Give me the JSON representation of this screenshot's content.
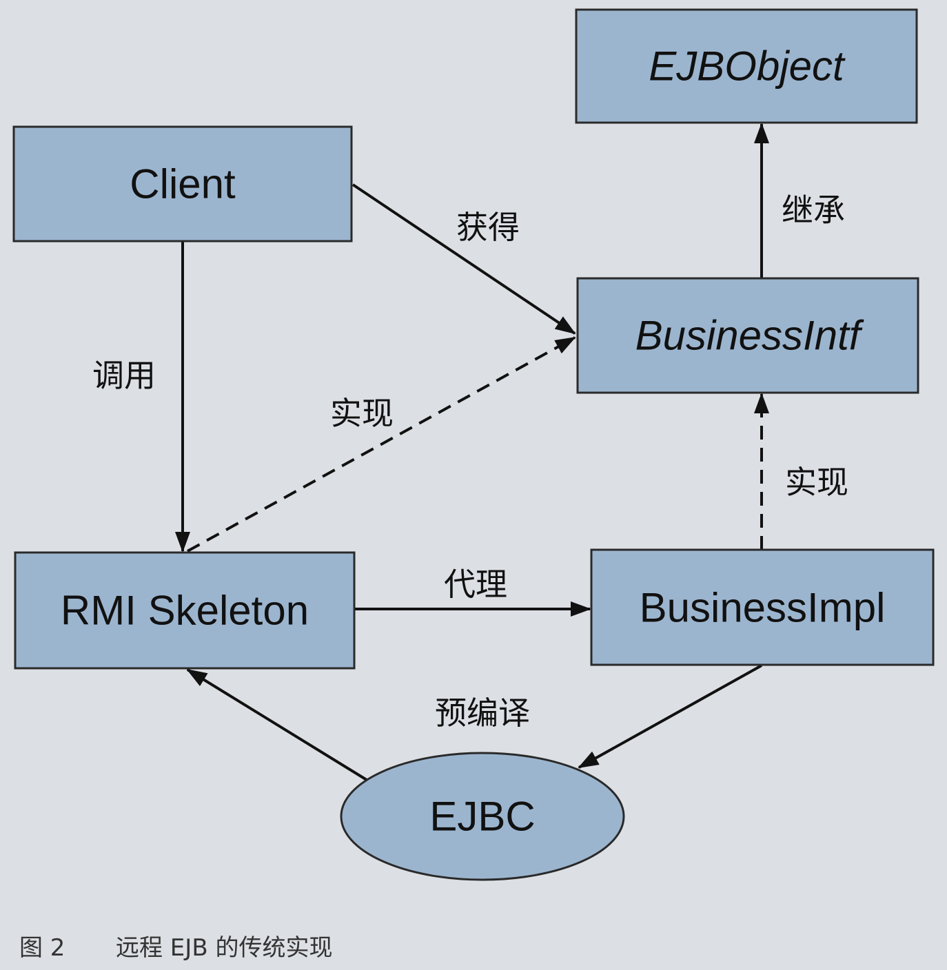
{
  "nodes": {
    "ejbobject": "EJBObject",
    "client": "Client",
    "business_intf": "BusinessIntf",
    "rmi_skeleton": "RMI Skeleton",
    "business_impl": "BusinessImpl",
    "ejbc": "EJBC"
  },
  "edges": [
    {
      "label": "获得"
    },
    {
      "label": "调用"
    },
    {
      "label": "实现"
    },
    {
      "label": "继承"
    },
    {
      "label": "实现"
    },
    {
      "label": "代理"
    },
    {
      "label": "预编译"
    },
    {}
  ],
  "caption": {
    "figure_number": "图 2",
    "text": "远程 EJB 的传统实现"
  },
  "colors": {
    "background": "#dcdfe4",
    "box_fill": "#9cb5cf",
    "border": "#2a2a2a",
    "text": "#111111"
  }
}
